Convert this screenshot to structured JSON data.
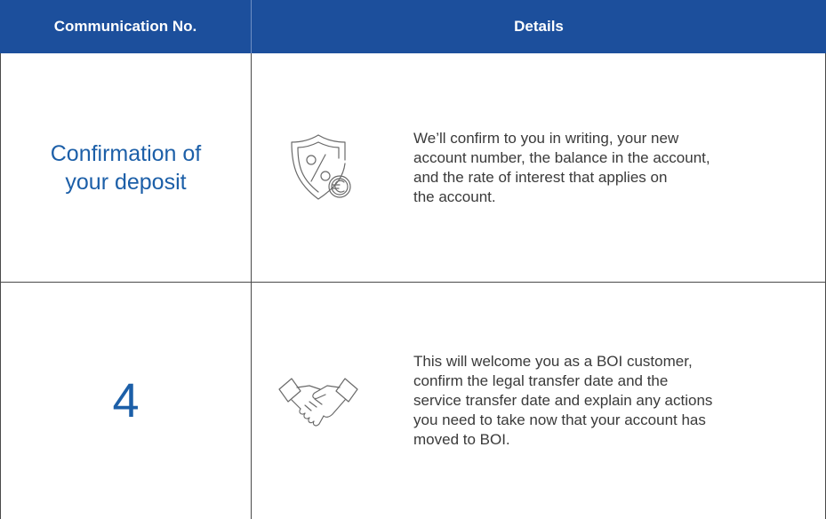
{
  "table": {
    "headers": {
      "col1": "Communication No.",
      "col2": "Details"
    },
    "rows": [
      {
        "label": "Confirmation of your deposit",
        "icon": "shield-percent-euro-icon",
        "detail": "We’ll confirm to you in writing, your new\naccount number, the balance in the account,\nand the rate of interest that applies on\nthe account."
      },
      {
        "label": "4",
        "icon": "handshake-icon",
        "detail": "This will welcome you as a BOI customer,\nconfirm the legal transfer date and the\nservice transfer date and explain any actions\nyou need to take now that your account has\nmoved to BOI."
      }
    ]
  },
  "colors": {
    "header_bg": "#1c4f9c",
    "header_text": "#ffffff",
    "label_text": "#1c5fa8",
    "body_text": "#3a3a3a",
    "border": "#4a4a4a"
  }
}
